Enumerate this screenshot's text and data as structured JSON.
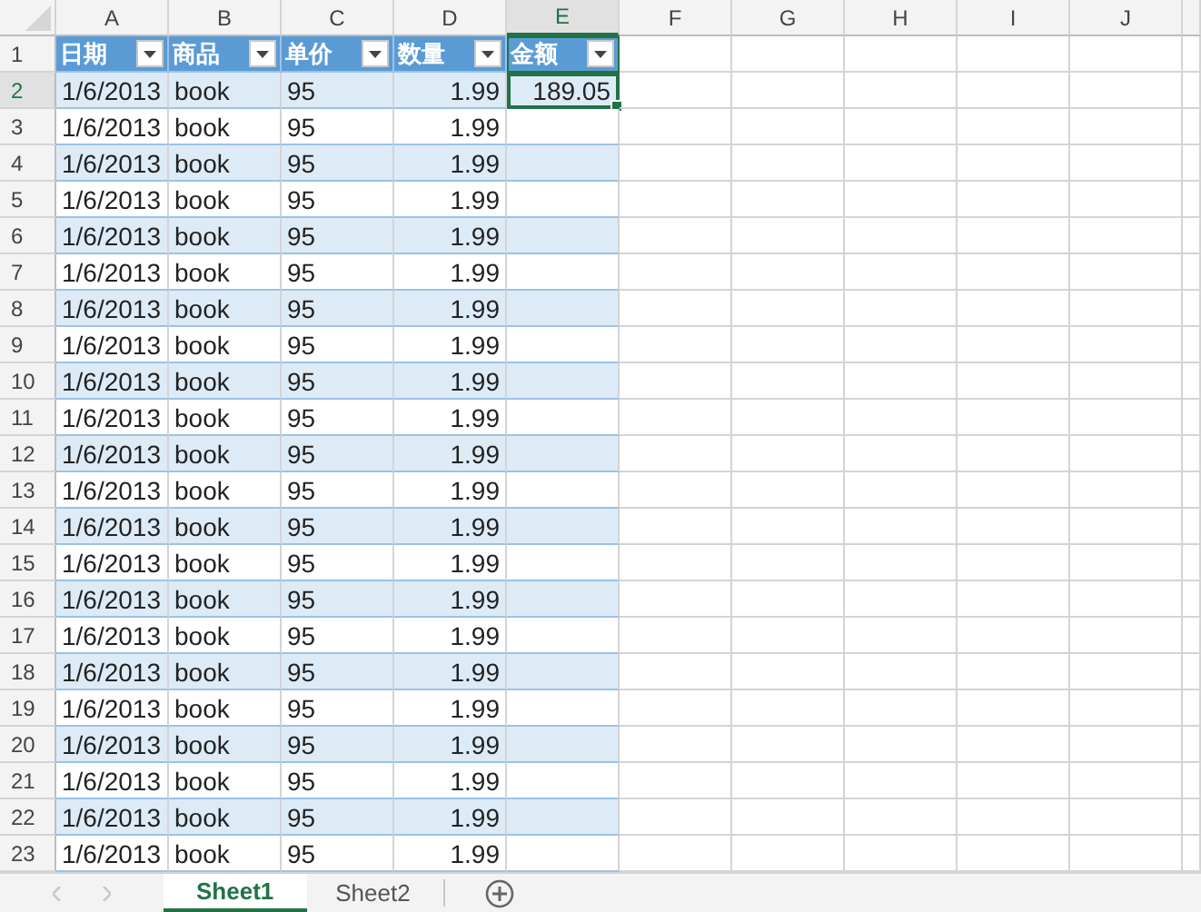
{
  "columns": [
    {
      "label": "A",
      "selected": false
    },
    {
      "label": "B",
      "selected": false
    },
    {
      "label": "C",
      "selected": false
    },
    {
      "label": "D",
      "selected": false
    },
    {
      "label": "E",
      "selected": true
    },
    {
      "label": "F",
      "selected": false
    },
    {
      "label": "G",
      "selected": false
    },
    {
      "label": "H",
      "selected": false
    },
    {
      "label": "I",
      "selected": false
    },
    {
      "label": "J",
      "selected": false
    }
  ],
  "header_row": {
    "number": "1",
    "cells": [
      "日期",
      "商品",
      "单价",
      "数量",
      "金额"
    ]
  },
  "rows": [
    {
      "number": "2",
      "selected": true,
      "cells": [
        "1/6/2013",
        "book",
        "95",
        "1.99",
        "189.05"
      ]
    },
    {
      "number": "3",
      "selected": false,
      "cells": [
        "1/6/2013",
        "book",
        "95",
        "1.99"
      ]
    },
    {
      "number": "4",
      "selected": false,
      "cells": [
        "1/6/2013",
        "book",
        "95",
        "1.99"
      ]
    },
    {
      "number": "5",
      "selected": false,
      "cells": [
        "1/6/2013",
        "book",
        "95",
        "1.99"
      ]
    },
    {
      "number": "6",
      "selected": false,
      "cells": [
        "1/6/2013",
        "book",
        "95",
        "1.99"
      ]
    },
    {
      "number": "7",
      "selected": false,
      "cells": [
        "1/6/2013",
        "book",
        "95",
        "1.99"
      ]
    },
    {
      "number": "8",
      "selected": false,
      "cells": [
        "1/6/2013",
        "book",
        "95",
        "1.99"
      ]
    },
    {
      "number": "9",
      "selected": false,
      "cells": [
        "1/6/2013",
        "book",
        "95",
        "1.99"
      ]
    },
    {
      "number": "10",
      "selected": false,
      "cells": [
        "1/6/2013",
        "book",
        "95",
        "1.99"
      ]
    },
    {
      "number": "11",
      "selected": false,
      "cells": [
        "1/6/2013",
        "book",
        "95",
        "1.99"
      ]
    },
    {
      "number": "12",
      "selected": false,
      "cells": [
        "1/6/2013",
        "book",
        "95",
        "1.99"
      ]
    },
    {
      "number": "13",
      "selected": false,
      "cells": [
        "1/6/2013",
        "book",
        "95",
        "1.99"
      ]
    },
    {
      "number": "14",
      "selected": false,
      "cells": [
        "1/6/2013",
        "book",
        "95",
        "1.99"
      ]
    },
    {
      "number": "15",
      "selected": false,
      "cells": [
        "1/6/2013",
        "book",
        "95",
        "1.99"
      ]
    },
    {
      "number": "16",
      "selected": false,
      "cells": [
        "1/6/2013",
        "book",
        "95",
        "1.99"
      ]
    },
    {
      "number": "17",
      "selected": false,
      "cells": [
        "1/6/2013",
        "book",
        "95",
        "1.99"
      ]
    },
    {
      "number": "18",
      "selected": false,
      "cells": [
        "1/6/2013",
        "book",
        "95",
        "1.99"
      ]
    },
    {
      "number": "19",
      "selected": false,
      "cells": [
        "1/6/2013",
        "book",
        "95",
        "1.99"
      ]
    },
    {
      "number": "20",
      "selected": false,
      "cells": [
        "1/6/2013",
        "book",
        "95",
        "1.99"
      ]
    },
    {
      "number": "21",
      "selected": false,
      "cells": [
        "1/6/2013",
        "book",
        "95",
        "1.99"
      ]
    },
    {
      "number": "22",
      "selected": false,
      "cells": [
        "1/6/2013",
        "book",
        "95",
        "1.99"
      ]
    },
    {
      "number": "23",
      "selected": false,
      "cells": [
        "1/6/2013",
        "book",
        "95",
        "1.99"
      ]
    }
  ],
  "sheet_tabs": [
    {
      "label": "Sheet1",
      "selected": true
    },
    {
      "label": "Sheet2",
      "selected": false
    }
  ]
}
